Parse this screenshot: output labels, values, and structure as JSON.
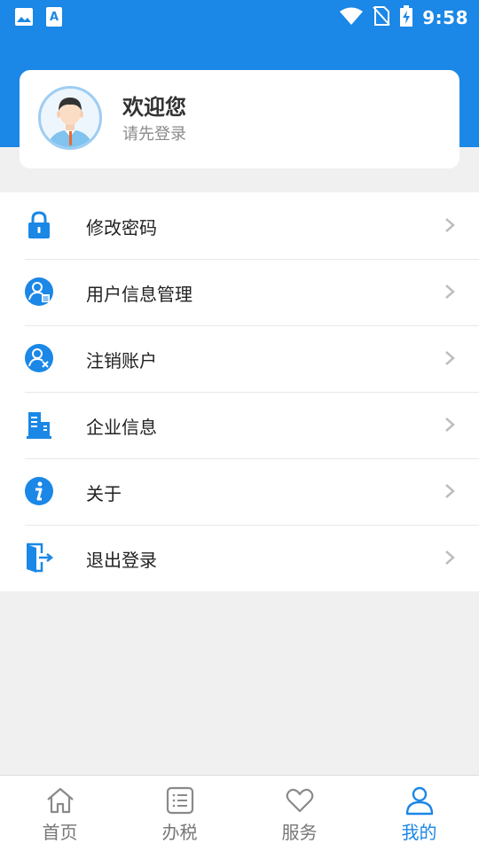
{
  "colors": {
    "primary": "#1b87e6",
    "background": "#f0f0f0",
    "text": "#222222",
    "muted": "#8a8a8a"
  },
  "status_bar": {
    "time": "9:58",
    "icons": [
      "image-icon",
      "text-a-icon",
      "wifi-icon",
      "no-sim-icon",
      "battery-charging-icon"
    ]
  },
  "profile": {
    "welcome": "欢迎您",
    "login_hint": "请先登录",
    "avatar_icon": "user-avatar-icon"
  },
  "menu": [
    {
      "label": "修改密码",
      "icon": "lock-icon"
    },
    {
      "label": "用户信息管理",
      "icon": "user-info-icon"
    },
    {
      "label": "注销账户",
      "icon": "user-cancel-icon"
    },
    {
      "label": "企业信息",
      "icon": "building-icon"
    },
    {
      "label": "关于",
      "icon": "info-icon"
    },
    {
      "label": "退出登录",
      "icon": "logout-icon"
    }
  ],
  "tabs": [
    {
      "label": "首页",
      "icon": "home-icon",
      "active": false
    },
    {
      "label": "办税",
      "icon": "list-icon",
      "active": false
    },
    {
      "label": "服务",
      "icon": "heart-icon",
      "active": false
    },
    {
      "label": "我的",
      "icon": "person-icon",
      "active": true
    }
  ]
}
